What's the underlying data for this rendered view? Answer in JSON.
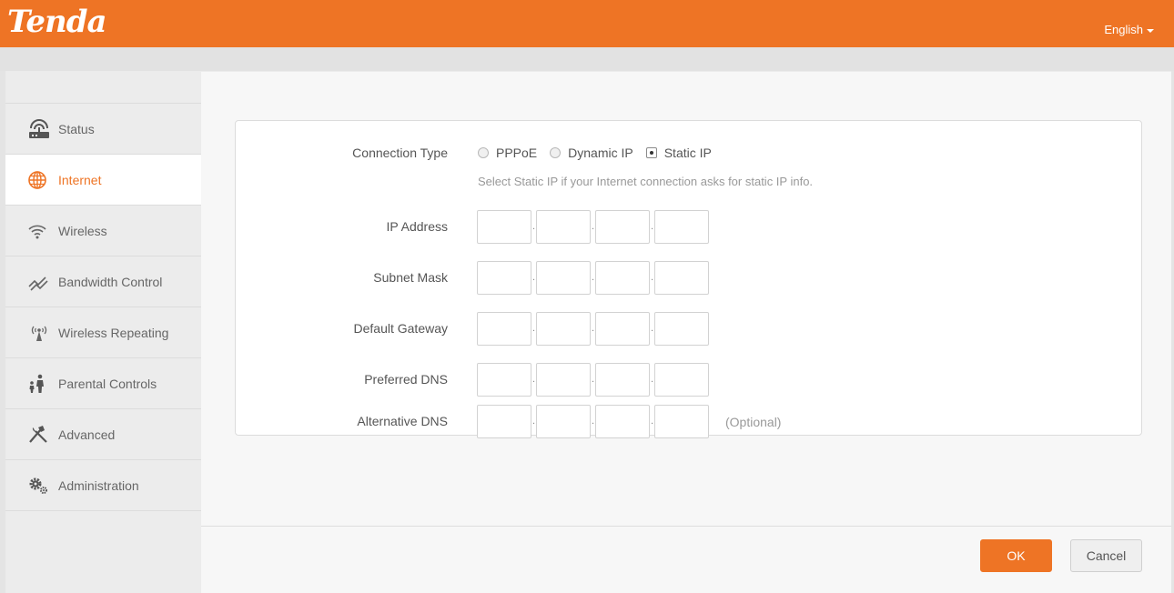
{
  "header": {
    "logo": "Tenda",
    "language": "English"
  },
  "sidebar": {
    "items": [
      {
        "label": "Status",
        "icon": "router-icon"
      },
      {
        "label": "Internet",
        "icon": "globe-icon",
        "active": true
      },
      {
        "label": "Wireless",
        "icon": "wifi-icon"
      },
      {
        "label": "Bandwidth Control",
        "icon": "bandwidth-icon"
      },
      {
        "label": "Wireless Repeating",
        "icon": "repeater-icon"
      },
      {
        "label": "Parental Controls",
        "icon": "parental-icon"
      },
      {
        "label": "Advanced",
        "icon": "tools-icon"
      },
      {
        "label": "Administration",
        "icon": "gears-icon"
      }
    ]
  },
  "form": {
    "connection_type_label": "Connection Type",
    "options": [
      {
        "label": "PPPoE",
        "checked": false
      },
      {
        "label": "Dynamic IP",
        "checked": false
      },
      {
        "label": "Static IP",
        "checked": true
      }
    ],
    "hint": "Select Static IP if your Internet connection asks for static IP info.",
    "fields": [
      {
        "label": "IP Address",
        "values": [
          "",
          "",
          "",
          ""
        ]
      },
      {
        "label": "Subnet Mask",
        "values": [
          "",
          "",
          "",
          ""
        ]
      },
      {
        "label": "Default Gateway",
        "values": [
          "",
          "",
          "",
          ""
        ]
      },
      {
        "label": "Preferred DNS",
        "values": [
          "",
          "",
          "",
          ""
        ]
      },
      {
        "label": "Alternative DNS",
        "values": [
          "",
          "",
          "",
          ""
        ],
        "suffix": "(Optional)"
      }
    ],
    "separator": "."
  },
  "footer": {
    "ok_label": "OK",
    "cancel_label": "Cancel"
  },
  "colors": {
    "accent": "#ee7425"
  }
}
